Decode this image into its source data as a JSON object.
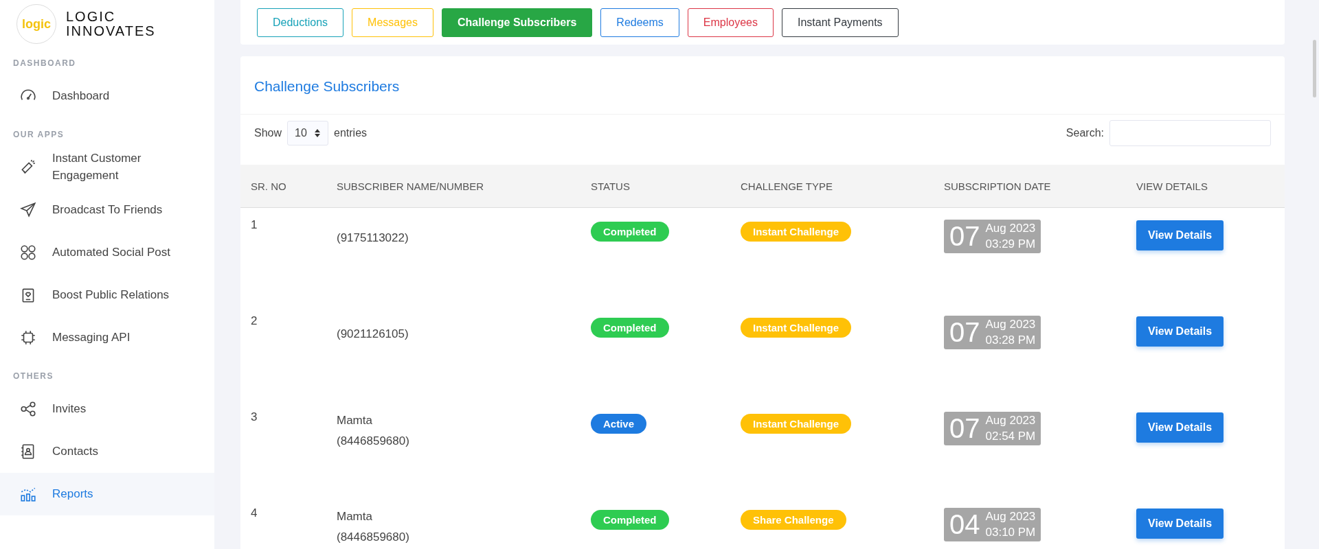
{
  "brand": {
    "logo_mark": "logic",
    "name_lines": [
      "LOGIC",
      "INNOVATES"
    ]
  },
  "sidebar": {
    "sections": [
      {
        "title": "DASHBOARD",
        "items": [
          {
            "label": "Dashboard",
            "selected": false
          }
        ]
      },
      {
        "title": "OUR APPS",
        "items": [
          {
            "label": "Instant Customer Engagement",
            "selected": false
          },
          {
            "label": "Broadcast To Friends",
            "selected": false
          },
          {
            "label": "Automated Social Post",
            "selected": false
          },
          {
            "label": "Boost Public Relations",
            "selected": false
          },
          {
            "label": "Messaging API",
            "selected": false
          }
        ]
      },
      {
        "title": "OTHERS",
        "items": [
          {
            "label": "Invites",
            "selected": false
          },
          {
            "label": "Contacts",
            "selected": false
          },
          {
            "label": "Reports",
            "selected": true
          }
        ]
      }
    ]
  },
  "tabs": [
    {
      "label": "Deductions",
      "color": "#17a2b8",
      "selected": false
    },
    {
      "label": "Messages",
      "color": "#ffc107",
      "selected": false
    },
    {
      "label": "Challenge Subscribers",
      "color": "#28a745",
      "selected": true
    },
    {
      "label": "Redeems",
      "color": "#1e7be0",
      "selected": false
    },
    {
      "label": "Employees",
      "color": "#dc3545",
      "selected": false
    },
    {
      "label": "Instant Payments",
      "color": "#343a40",
      "selected": false
    }
  ],
  "panel": {
    "title": "Challenge Subscribers",
    "show_label": "Show",
    "entries_value": "10",
    "entries_label": "entries",
    "search_label": "Search:"
  },
  "table": {
    "columns": [
      "SR. NO",
      "SUBSCRIBER NAME/NUMBER",
      "STATUS",
      "CHALLENGE TYPE",
      "SUBSCRIPTION DATE",
      "VIEW DETAILS"
    ],
    "rows": [
      {
        "sr": "1",
        "number": "(9175113022)",
        "status": "Completed",
        "color": "#2ecc52",
        "type": "Instant Challenge",
        "day": "07",
        "month_year": "Aug 2023",
        "time": "03:29 PM",
        "action": "View Details"
      },
      {
        "sr": "2",
        "number": "(9021126105)",
        "status": "Completed",
        "color": "#2ecc52",
        "type": "Instant Challenge",
        "day": "07",
        "month_year": "Aug 2023",
        "time": "03:28 PM",
        "action": "View Details"
      },
      {
        "sr": "3",
        "name": "Mamta",
        "number": "(8446859680)",
        "status": "Active",
        "color": "#1e7be0",
        "type": "Instant Challenge",
        "day": "07",
        "month_year": "Aug 2023",
        "time": "02:54 PM",
        "action": "View Details"
      },
      {
        "sr": "4",
        "name": "Mamta",
        "number": "(8446859680)",
        "status": "Completed",
        "color": "#2ecc52",
        "type": "Share Challenge",
        "day": "04",
        "month_year": "Aug 2023",
        "time": "03:10 PM",
        "action": "View Details"
      }
    ]
  }
}
